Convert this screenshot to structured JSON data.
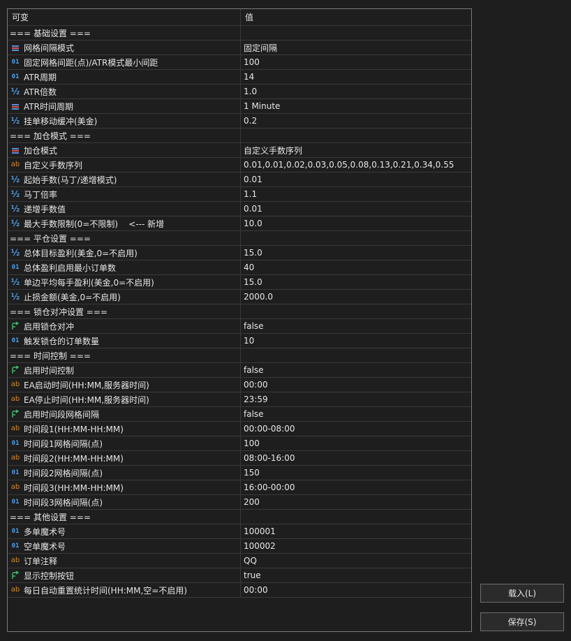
{
  "columns": {
    "name": "可变",
    "value": "值"
  },
  "rows": [
    {
      "type": "section",
      "name": "=== 基础设置 ===",
      "value": ""
    },
    {
      "type": "enum",
      "icon": "enum-icon",
      "name": "网格间隔模式",
      "value": "固定间隔"
    },
    {
      "type": "int",
      "icon": "int-icon",
      "name": "固定网格间距(点)/ATR模式最小间距",
      "value": "100"
    },
    {
      "type": "int",
      "icon": "int-icon",
      "name": "ATR周期",
      "value": "14"
    },
    {
      "type": "double",
      "icon": "double-icon",
      "name": "ATR倍数",
      "value": "1.0"
    },
    {
      "type": "enum",
      "icon": "enum-icon",
      "name": "ATR时间周期",
      "value": "1 Minute"
    },
    {
      "type": "double",
      "icon": "double-icon",
      "name": "挂单移动缓冲(美金)",
      "value": "0.2"
    },
    {
      "type": "section",
      "name": "=== 加仓模式 ===",
      "value": ""
    },
    {
      "type": "enum",
      "icon": "enum-icon",
      "name": "加仓模式",
      "value": "自定义手数序列"
    },
    {
      "type": "string",
      "icon": "string-icon",
      "name": "自定义手数序列",
      "value": "0.01,0.01,0.02,0.03,0.05,0.08,0.13,0.21,0.34,0.55"
    },
    {
      "type": "double",
      "icon": "double-icon",
      "name": "起始手数(马丁/递增模式)",
      "value": "0.01"
    },
    {
      "type": "double",
      "icon": "double-icon",
      "name": "马丁倍率",
      "value": "1.1"
    },
    {
      "type": "double",
      "icon": "double-icon",
      "name": "递增手数值",
      "value": "0.01"
    },
    {
      "type": "double",
      "icon": "double-icon",
      "name": "最大手数限制(0=不限制)    <--- 新增",
      "value": "10.0"
    },
    {
      "type": "section",
      "name": "=== 平仓设置 ===",
      "value": ""
    },
    {
      "type": "double",
      "icon": "double-icon",
      "name": "总体目标盈利(美金,0=不启用)",
      "value": "15.0"
    },
    {
      "type": "int",
      "icon": "int-icon",
      "name": "总体盈利启用最小订单数",
      "value": "40"
    },
    {
      "type": "double",
      "icon": "double-icon",
      "name": "单边平均每手盈利(美金,0=不启用)",
      "value": "15.0"
    },
    {
      "type": "double",
      "icon": "double-icon",
      "name": "止损金额(美金,0=不启用)",
      "value": "2000.0"
    },
    {
      "type": "section",
      "name": "=== 锁仓对冲设置 ===",
      "value": ""
    },
    {
      "type": "bool",
      "icon": "bool-icon",
      "name": "启用锁仓对冲",
      "value": "false"
    },
    {
      "type": "int",
      "icon": "int-icon",
      "name": "触发锁仓的订单数量",
      "value": "10"
    },
    {
      "type": "section",
      "name": "=== 时间控制 ===",
      "value": ""
    },
    {
      "type": "bool",
      "icon": "bool-icon",
      "name": "启用时间控制",
      "value": "false"
    },
    {
      "type": "string",
      "icon": "string-icon",
      "name": "EA启动时间(HH:MM,服务器时间)",
      "value": "00:00"
    },
    {
      "type": "string",
      "icon": "string-icon",
      "name": "EA停止时间(HH:MM,服务器时间)",
      "value": "23:59"
    },
    {
      "type": "bool",
      "icon": "bool-icon",
      "name": "启用时间段网格间隔",
      "value": "false"
    },
    {
      "type": "string",
      "icon": "string-icon",
      "name": "时间段1(HH:MM-HH:MM)",
      "value": "00:00-08:00"
    },
    {
      "type": "int",
      "icon": "int-icon",
      "name": "时间段1网格间隔(点)",
      "value": "100"
    },
    {
      "type": "string",
      "icon": "string-icon",
      "name": "时间段2(HH:MM-HH:MM)",
      "value": "08:00-16:00"
    },
    {
      "type": "int",
      "icon": "int-icon",
      "name": "时间段2网格间隔(点)",
      "value": "150"
    },
    {
      "type": "string",
      "icon": "string-icon",
      "name": "时间段3(HH:MM-HH:MM)",
      "value": "16:00-00:00"
    },
    {
      "type": "int",
      "icon": "int-icon",
      "name": "时间段3网格间隔(点)",
      "value": "200"
    },
    {
      "type": "section",
      "name": "=== 其他设置 ===",
      "value": ""
    },
    {
      "type": "int",
      "icon": "int-icon",
      "name": "多单魔术号",
      "value": "100001"
    },
    {
      "type": "int",
      "icon": "int-icon",
      "name": "空单魔术号",
      "value": "100002"
    },
    {
      "type": "string",
      "icon": "string-icon",
      "name": "订单注释",
      "value": "QQ"
    },
    {
      "type": "bool",
      "icon": "bool-icon",
      "name": "显示控制按钮",
      "value": "true"
    },
    {
      "type": "string",
      "icon": "string-icon",
      "name": "每日自动重置统计时间(HH:MM,空=不启用)",
      "value": "00:00"
    }
  ],
  "icon_glyphs": {
    "int": "01",
    "double": "½",
    "string": "ab"
  },
  "buttons": {
    "load": "载入(L)",
    "save": "保存(S)"
  },
  "colors": {
    "int_icon": "#4f9ee8",
    "double_icon": "#4f9ee8",
    "string_icon": "#d98a2b",
    "bool_icon": "#3fb86b",
    "enum_icon_top": "#5b8fd9",
    "enum_icon_bottom": "#d9534f"
  }
}
